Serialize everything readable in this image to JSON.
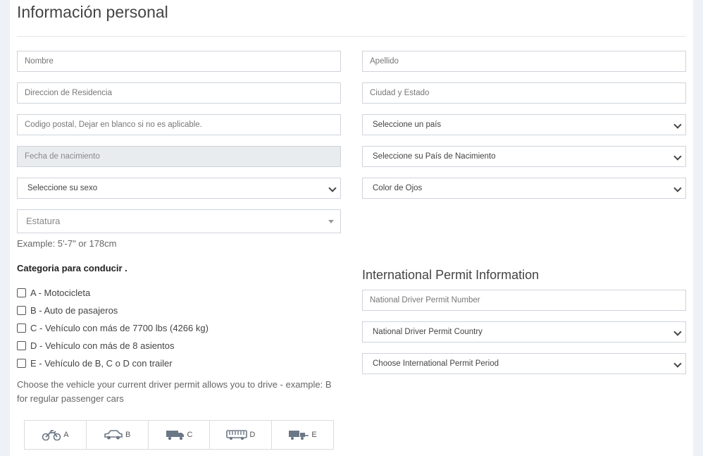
{
  "heading": "Información personal",
  "fields": {
    "nombre": "Nombre",
    "apellido": "Apellido",
    "direccion": "Direccion de Residencia",
    "ciudad": "Ciudad y Estado",
    "codigo_postal": "Codigo postal, Dejar en blanco si no es aplicable.",
    "pais": "Seleccione un país",
    "fecha_nacimiento": "Fecha de nacimiento",
    "pais_nacimiento": "Seleccione su País de Nacimiento",
    "sexo": "Seleccione su sexo",
    "color_ojos": "Color de Ojos",
    "estatura": "Estatura"
  },
  "estatura_hint": "Example: 5'-7\" or 178cm",
  "categoria_label": "Categoria para conducir .",
  "categorias": [
    "A - Motocicleta",
    "B - Auto de pasajeros",
    "C - Vehículo con más de 7700 lbs (4266 kg)",
    "D - Vehículo con más de 8 asientos",
    "E - Vehículo de B, C o D con trailer"
  ],
  "vehicle_hint": "Choose the vehicle your current driver permit allows you to drive - example: B for regular passenger cars",
  "vehicle_classes": [
    {
      "letter": "A",
      "icon": "motorcycle-icon"
    },
    {
      "letter": "B",
      "icon": "car-icon"
    },
    {
      "letter": "C",
      "icon": "truck-icon"
    },
    {
      "letter": "D",
      "icon": "bus-icon"
    },
    {
      "letter": "E",
      "icon": "trailer-icon"
    }
  ],
  "permit": {
    "title": "International Permit Information",
    "number": "National Driver Permit Number",
    "country": "National Driver Permit Country",
    "period": "Choose International Permit Period"
  }
}
